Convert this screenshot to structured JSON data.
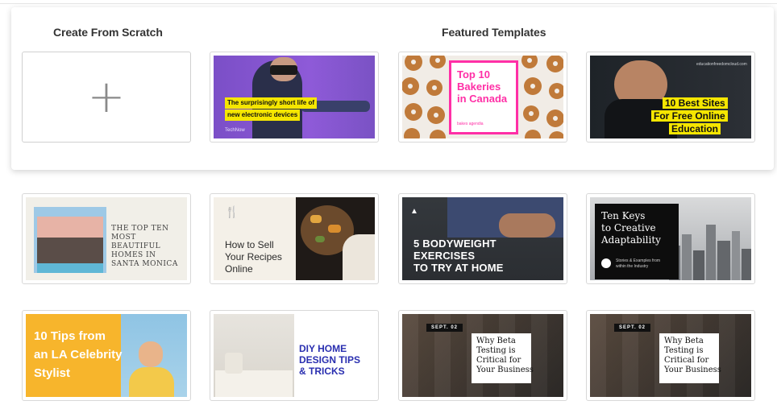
{
  "headings": {
    "scratch": "Create From Scratch",
    "featured": "Featured Templates"
  },
  "scratch_icon": "plus-icon",
  "plus_glyph": "+",
  "templates": [
    {
      "title": "The surprisingly short life of new electronic devices",
      "line1": "The surprisingly short life of",
      "line2": "new electronic devices",
      "brand": "TechNow"
    },
    {
      "title": "Top 10 Bakeries in Canada",
      "line1": "Top 10",
      "line2": "Bakeries",
      "line3": "in Canada",
      "brand": "bakes agendia"
    },
    {
      "title": "10 Best Sites For Free Online Education",
      "line1": "10 Best Sites",
      "line2": "For Free Online",
      "line3": "Education",
      "url": "educationfreedomcloud.com"
    },
    {
      "title": "The Top Ten Most Beautiful Homes in Santa Monica",
      "line1": "THE TOP TEN",
      "line2": "MOST BEAUTIFUL",
      "line3": "HOMES IN",
      "line4": "SANTA MONICA"
    },
    {
      "title": "How to Sell Your Recipes Online",
      "line1": "How to Sell",
      "line2": "Your Recipes",
      "line3": "Online"
    },
    {
      "title": "5 Bodyweight Exercises to Try at Home",
      "line1": "5 BODYWEIGHT",
      "line2": "EXERCISES",
      "line3": "TO TRY AT HOME"
    },
    {
      "title": "Ten Keys to Creative Adaptability",
      "line1": "Ten Keys",
      "line2": "to Creative",
      "line3": "Adaptability",
      "sub": "Stories & Examples from within the Industry"
    },
    {
      "title": "10 Tips from an LA Celebrity Stylist",
      "line1": "10 Tips from",
      "line2": "an LA Celebrity",
      "line3": "Stylist"
    },
    {
      "title": "DIY Home Design Tips & Tricks",
      "line1": "DIY HOME",
      "line2": "DESIGN TIPS",
      "line3": "& TRICKS"
    },
    {
      "title": "Why Beta Testing is Critical for Your Business",
      "date": "SEPT. 02",
      "line1": "Why Beta",
      "line2": "Testing is",
      "line3": "Critical for",
      "line4": "Your Business"
    },
    {
      "title": "Why Beta Testing is Critical for Your Business",
      "date": "SEPT. 02",
      "line1": "Why Beta",
      "line2": "Testing is",
      "line3": "Critical for",
      "line4": "Your Business"
    }
  ]
}
